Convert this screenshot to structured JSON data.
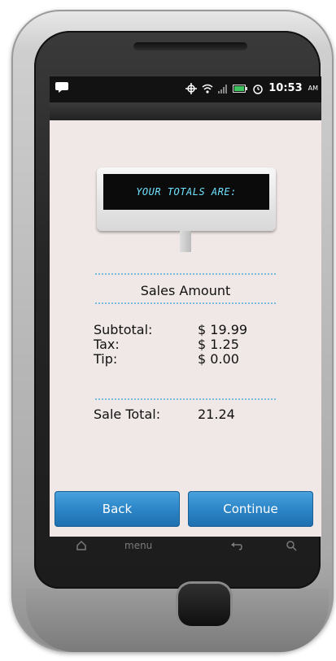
{
  "status_bar": {
    "time": "10:53",
    "ampm": "AM",
    "icons": [
      "notification-icon",
      "gps-icon",
      "wifi-icon",
      "signal-icon",
      "battery-icon",
      "alarm-icon"
    ]
  },
  "display_sign": {
    "text": "YOUR TOTALS ARE:"
  },
  "sales": {
    "title": "Sales Amount",
    "rows": [
      {
        "label": "Subtotal:",
        "value": "$ 19.99"
      },
      {
        "label": "Tax:",
        "value": "$ 1.25"
      },
      {
        "label": "Tip:",
        "value": "$ 0.00"
      }
    ],
    "total_label": "Sale Total:",
    "total_value": "21.24"
  },
  "buttons": {
    "back": "Back",
    "continue": "Continue"
  },
  "nav_bar": {
    "home": "Home",
    "menu": "menu",
    "back_icon": "back-icon",
    "search_icon": "search-icon"
  },
  "colors": {
    "button_blue": "#2c86c8",
    "screen_bg": "#f0e8e6",
    "dotted_line": "#76bcd8",
    "sign_text": "#6fe3ff"
  }
}
